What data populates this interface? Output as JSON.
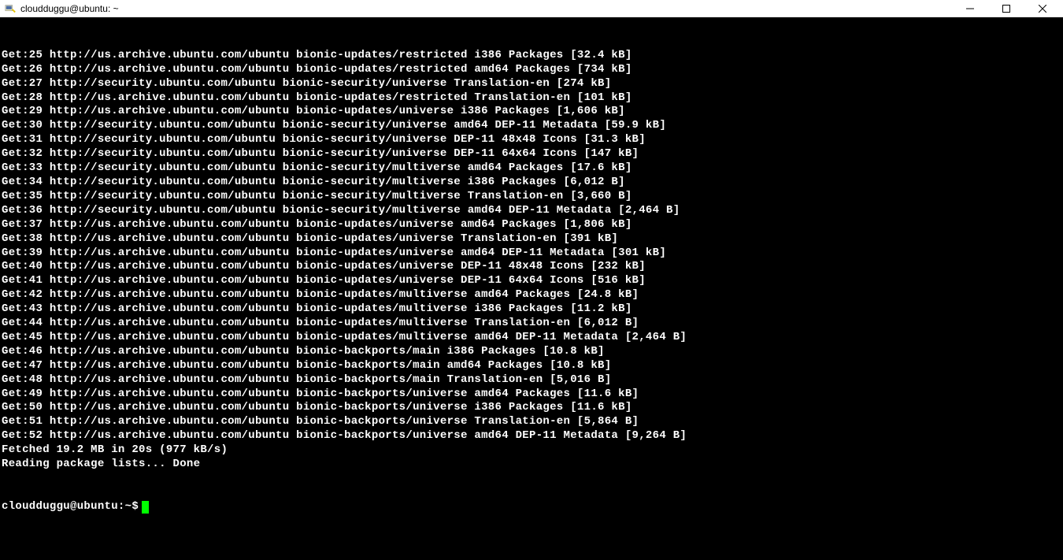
{
  "window": {
    "title": "cloudduggu@ubuntu: ~"
  },
  "terminal": {
    "lines": [
      "Get:25 http://us.archive.ubuntu.com/ubuntu bionic-updates/restricted i386 Packages [32.4 kB]",
      "Get:26 http://us.archive.ubuntu.com/ubuntu bionic-updates/restricted amd64 Packages [734 kB]",
      "Get:27 http://security.ubuntu.com/ubuntu bionic-security/universe Translation-en [274 kB]",
      "Get:28 http://us.archive.ubuntu.com/ubuntu bionic-updates/restricted Translation-en [101 kB]",
      "Get:29 http://us.archive.ubuntu.com/ubuntu bionic-updates/universe i386 Packages [1,606 kB]",
      "Get:30 http://security.ubuntu.com/ubuntu bionic-security/universe amd64 DEP-11 Metadata [59.9 kB]",
      "Get:31 http://security.ubuntu.com/ubuntu bionic-security/universe DEP-11 48x48 Icons [31.3 kB]",
      "Get:32 http://security.ubuntu.com/ubuntu bionic-security/universe DEP-11 64x64 Icons [147 kB]",
      "Get:33 http://security.ubuntu.com/ubuntu bionic-security/multiverse amd64 Packages [17.6 kB]",
      "Get:34 http://security.ubuntu.com/ubuntu bionic-security/multiverse i386 Packages [6,012 B]",
      "Get:35 http://security.ubuntu.com/ubuntu bionic-security/multiverse Translation-en [3,660 B]",
      "Get:36 http://security.ubuntu.com/ubuntu bionic-security/multiverse amd64 DEP-11 Metadata [2,464 B]",
      "Get:37 http://us.archive.ubuntu.com/ubuntu bionic-updates/universe amd64 Packages [1,806 kB]",
      "Get:38 http://us.archive.ubuntu.com/ubuntu bionic-updates/universe Translation-en [391 kB]",
      "Get:39 http://us.archive.ubuntu.com/ubuntu bionic-updates/universe amd64 DEP-11 Metadata [301 kB]",
      "Get:40 http://us.archive.ubuntu.com/ubuntu bionic-updates/universe DEP-11 48x48 Icons [232 kB]",
      "Get:41 http://us.archive.ubuntu.com/ubuntu bionic-updates/universe DEP-11 64x64 Icons [516 kB]",
      "Get:42 http://us.archive.ubuntu.com/ubuntu bionic-updates/multiverse amd64 Packages [24.8 kB]",
      "Get:43 http://us.archive.ubuntu.com/ubuntu bionic-updates/multiverse i386 Packages [11.2 kB]",
      "Get:44 http://us.archive.ubuntu.com/ubuntu bionic-updates/multiverse Translation-en [6,012 B]",
      "Get:45 http://us.archive.ubuntu.com/ubuntu bionic-updates/multiverse amd64 DEP-11 Metadata [2,464 B]",
      "Get:46 http://us.archive.ubuntu.com/ubuntu bionic-backports/main i386 Packages [10.8 kB]",
      "Get:47 http://us.archive.ubuntu.com/ubuntu bionic-backports/main amd64 Packages [10.8 kB]",
      "Get:48 http://us.archive.ubuntu.com/ubuntu bionic-backports/main Translation-en [5,016 B]",
      "Get:49 http://us.archive.ubuntu.com/ubuntu bionic-backports/universe amd64 Packages [11.6 kB]",
      "Get:50 http://us.archive.ubuntu.com/ubuntu bionic-backports/universe i386 Packages [11.6 kB]",
      "Get:51 http://us.archive.ubuntu.com/ubuntu bionic-backports/universe Translation-en [5,864 B]",
      "Get:52 http://us.archive.ubuntu.com/ubuntu bionic-backports/universe amd64 DEP-11 Metadata [9,264 B]",
      "Fetched 19.2 MB in 20s (977 kB/s)",
      "Reading package lists... Done"
    ],
    "prompt": "cloudduggu@ubuntu:~$"
  }
}
